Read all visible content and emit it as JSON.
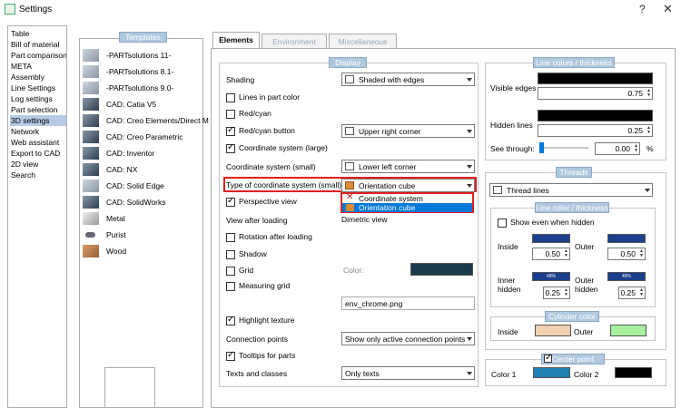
{
  "window": {
    "title": "Settings",
    "help": "?",
    "close": "✕"
  },
  "sidebar": {
    "items": [
      "Table",
      "Bill of material",
      "Part comparison",
      "META",
      "Assembly",
      "Line Settings",
      "Log settings",
      "Part selection",
      "3D settings",
      "Network",
      "Web assistant",
      "Export to CAD",
      "2D view",
      "Search"
    ],
    "selected_index": 8
  },
  "templates": {
    "header": "Templates",
    "items": [
      "-PARTsolutions 11-",
      "-PARTsolutions 8.1-",
      "-PARTsolutions 9.0-",
      "CAD: Catia V5",
      "CAD: Creo Elements/Direct M",
      "CAD: Creo Parametric",
      "CAD: Inventor",
      "CAD: NX",
      "CAD: Solid Edge",
      "CAD: SolidWorks",
      "Metal",
      "Purist",
      "Wood"
    ]
  },
  "tabs": [
    "Elements",
    "Environment",
    "Miscellaneous"
  ],
  "display": {
    "header": "Display",
    "shading_label": "Shading",
    "shading_value": "Shaded with edges",
    "lines_in_part_color": "Lines in part color",
    "red_cyan": "Red/cyan",
    "red_cyan_button": "Red/cyan button",
    "red_cyan_button_value": "Upper right corner",
    "coord_large": "Coordinate system (large)",
    "coord_small_label": "Coordinate system (small)",
    "coord_small_value": "Lower left corner",
    "type_coord_label": "Type of coordinate system (small)",
    "type_coord_value": "Orientation cube",
    "dropdown_options": [
      "Coordinate system",
      "Orientation cube"
    ],
    "perspective": "Perspective view",
    "view_after_loading_label": "View after loading",
    "view_after_loading_value": "Dimetric view",
    "rotation_after_loading": "Rotation after loading",
    "shadow": "Shadow",
    "grid": "Grid",
    "color_label": "Color:",
    "measuring_grid": "Measuring grid",
    "env_file": "env_chrome.png",
    "highlight_texture": "Highlight texture",
    "connection_points_label": "Connection points",
    "connection_points_value": "Show only active connection points",
    "tooltips": "Tooltips for parts",
    "texts_classes_label": "Texts and classes",
    "texts_classes_value": "Only texts"
  },
  "line_colors": {
    "header": "Line colors / thickness",
    "visible_edges": "Visible edges",
    "visible_value": "0.75",
    "hidden_lines": "Hidden lines",
    "hidden_value": "0.25",
    "see_through": "See through:",
    "see_through_value": "0.00",
    "percent": "%"
  },
  "threads": {
    "header": "Threads",
    "value": "Thread lines",
    "sub_header": "Line color / thickness",
    "show_hidden": "Show even when hidden",
    "inside": "Inside",
    "outer": "Outer",
    "inside_value": "0.50",
    "outer_value": "0.50",
    "inner_hidden": "Inner hidden",
    "outer_hidden": "Outer hidden",
    "inner_hidden_value": "0.25",
    "outer_hidden_value": "0.25",
    "swatch_text": "49%"
  },
  "cylinder": {
    "header": "Cylinder color",
    "inside": "Inside",
    "outer": "Outer"
  },
  "center_point": {
    "header": "Center point",
    "color1": "Color 1",
    "color2": "Color 2"
  },
  "colors": {
    "group_header": "#b0c8de",
    "highlight_red": "#e0201e",
    "dark_blue": "#1c3f8c",
    "selected_blue": "#0078d7",
    "grid_color": "#1b3a4b",
    "cylinder_inside": "#f2cfb0",
    "cylinder_outer": "#a8f0a0",
    "center_color1": "#1f7fb0"
  }
}
